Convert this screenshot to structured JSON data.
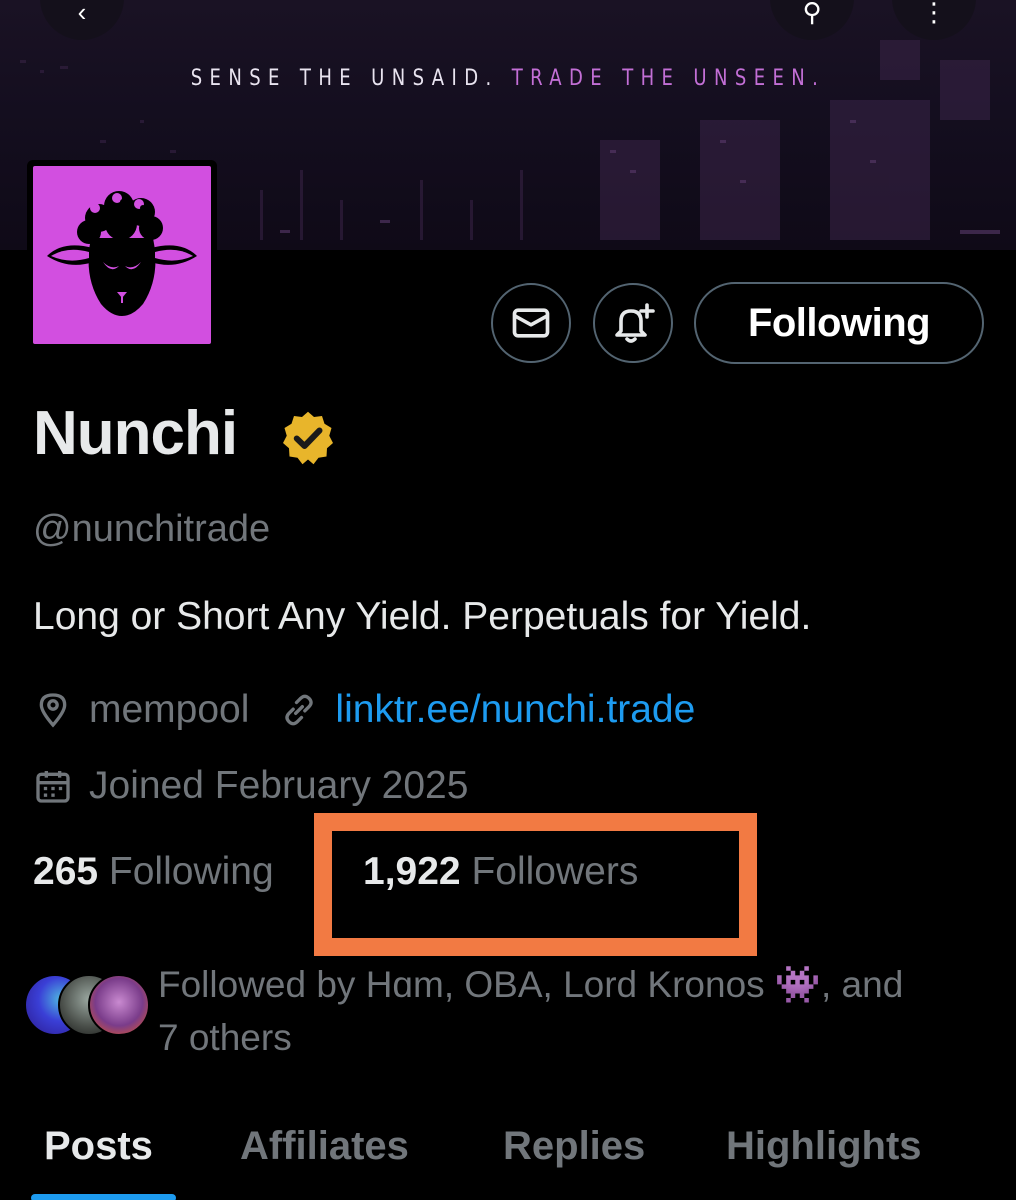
{
  "banner": {
    "tagline_part1": "SENSE THE UNSAID.",
    "tagline_part2": "TRADE THE UNSEEN.",
    "back_icon": "arrow-left-icon",
    "search_icon": "search-icon",
    "more_icon": "more-icon"
  },
  "profile": {
    "avatar_icon": "sheep-logo",
    "name": "Nunchi",
    "verified_icon": "verified-badge-icon",
    "handle": "@nunchitrade",
    "bio": "Long or Short Any Yield. Perpetuals for Yield.",
    "location": "mempool",
    "website": "linktr.ee/nunchi.trade",
    "joined": "Joined February 2025"
  },
  "actions": {
    "message_icon": "mail-icon",
    "notify_icon": "bell-plus-icon",
    "follow_label": "Following"
  },
  "stats": {
    "following_count": "265",
    "following_label": "Following",
    "followers_count": "1,922",
    "followers_label": "Followers"
  },
  "followed_by": {
    "line1": "Followed by Hɑm, OBA, Lord Kronos 👾, and",
    "line2": "7 others"
  },
  "tabs": [
    "Posts",
    "Affiliates",
    "Replies",
    "Highlights"
  ],
  "colors": {
    "accent": "#1d9bf0",
    "avatar_bg": "#d24fe0",
    "highlight_box": "#f27a43",
    "verified": "#e8b52b",
    "tagline_accent": "#c36fd6"
  }
}
